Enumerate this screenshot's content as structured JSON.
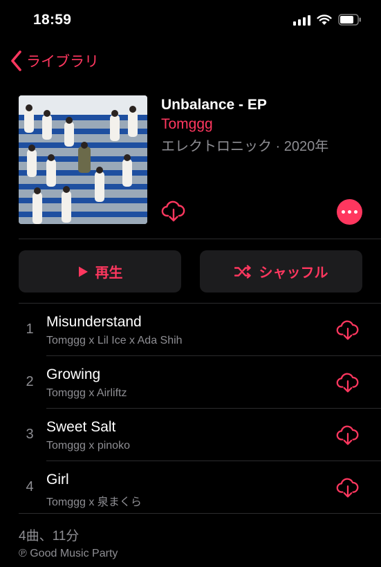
{
  "status": {
    "time": "18:59"
  },
  "nav": {
    "back_label": "ライブラリ"
  },
  "album": {
    "title": "Unbalance - EP",
    "artist": "Tomggg",
    "meta": "エレクトロニック · 2020年"
  },
  "actions": {
    "play_label": "再生",
    "shuffle_label": "シャッフル"
  },
  "tracks": [
    {
      "number": "1",
      "title": "Misunderstand",
      "artist": "Tomggg x Lil Ice x Ada Shih"
    },
    {
      "number": "2",
      "title": "Growing",
      "artist": "Tomggg x Airliftz"
    },
    {
      "number": "3",
      "title": "Sweet Salt",
      "artist": "Tomggg x pinoko"
    },
    {
      "number": "4",
      "title": "Girl",
      "artist": "Tomggg x 泉まくら"
    }
  ],
  "footer": {
    "count": "4曲、11分",
    "copyright": "℗ Good Music Party"
  },
  "colors": {
    "accent": "#ff375f",
    "secondary_text": "#8e8e93",
    "button_bg": "#1c1c1e"
  },
  "icons": [
    "chevron-left-icon",
    "cloud-download-icon",
    "more-icon",
    "play-icon",
    "shuffle-icon",
    "signal-icon",
    "wifi-icon",
    "battery-icon"
  ]
}
